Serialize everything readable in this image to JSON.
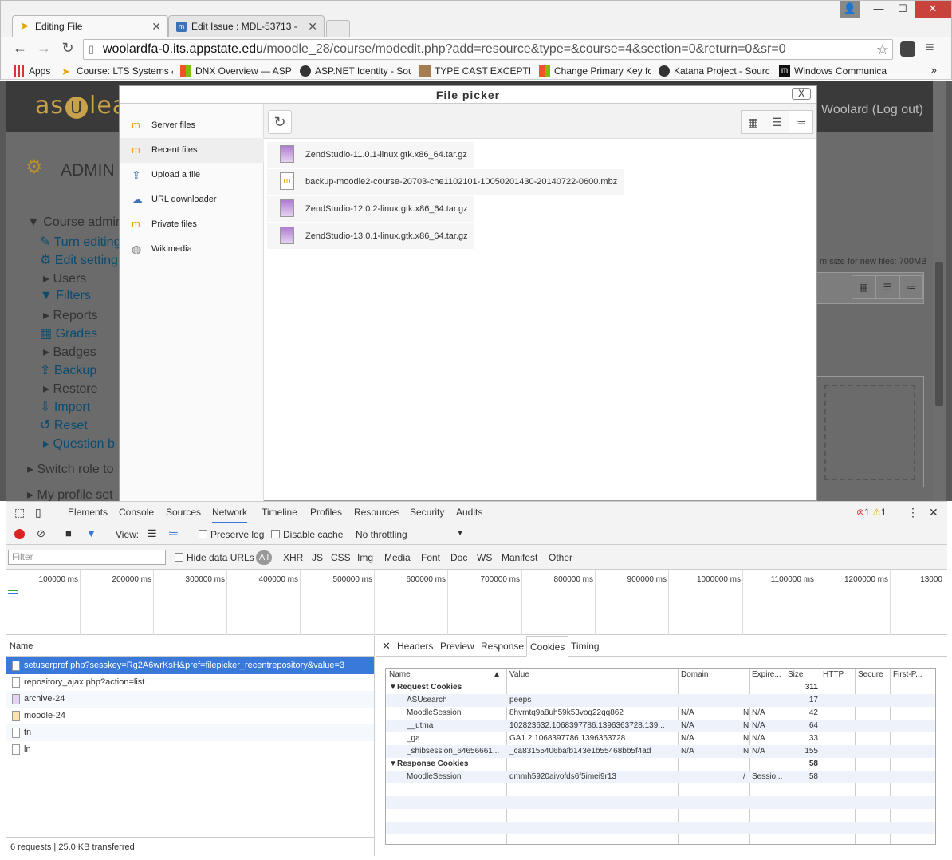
{
  "browser": {
    "tabs": [
      {
        "title": "Editing File",
        "active": true
      },
      {
        "title": "Edit Issue : MDL-53713 - ",
        "active": false
      }
    ],
    "url_host": "woolardfa-0.its.appstate.edu",
    "url_path": "/moodle_28/course/modedit.php?add=resource&type=&course=4&section=0&return=0&sr=0",
    "bookmarks": [
      "Apps",
      "Course: LTS Systems &",
      "DNX Overview — ASP",
      "ASP.NET Identity - Sou",
      "TYPE CAST EXCEPTION",
      "Change Primary Key fo",
      "Katana Project - Sourc",
      "Windows Communica"
    ]
  },
  "moodle": {
    "logo": "as",
    "logo_rest": "lea",
    "logout": "Woolard (Log out)",
    "admin_title": "ADMIN",
    "max_size": "m size for new files: 700MB",
    "nav": {
      "course_admin": "Course admin",
      "items": [
        {
          "label": "Turn editing",
          "link": true
        },
        {
          "label": "Edit setting",
          "link": true
        },
        {
          "label": "Users",
          "link": false
        },
        {
          "label": "Filters",
          "link": true
        },
        {
          "label": "Reports",
          "link": false
        },
        {
          "label": "Grades",
          "link": true
        },
        {
          "label": "Badges",
          "link": false
        },
        {
          "label": "Backup",
          "link": true
        },
        {
          "label": "Restore",
          "link": false
        },
        {
          "label": "Import",
          "link": true
        },
        {
          "label": "Reset",
          "link": true
        },
        {
          "label": "Question b",
          "link": true
        }
      ],
      "switch_role": "Switch role to",
      "my_profile": "My profile set"
    }
  },
  "filepicker": {
    "title": "File picker",
    "close": "X",
    "repositories": [
      {
        "label": "Server files",
        "icon": "moodle-icon",
        "active": false
      },
      {
        "label": "Recent files",
        "icon": "moodle-icon",
        "active": true
      },
      {
        "label": "Upload a file",
        "icon": "upload-icon",
        "active": false
      },
      {
        "label": "URL downloader",
        "icon": "url-icon",
        "active": false
      },
      {
        "label": "Private files",
        "icon": "moodle-icon",
        "active": false
      },
      {
        "label": "Wikimedia",
        "icon": "wikimedia-icon",
        "active": false
      }
    ],
    "files": [
      "ZendStudio-11.0.1-linux.gtk.x86_64.tar.gz",
      "backup-moodle2-course-20703-che1102101-10050201430-20140722-0600.mbz",
      "ZendStudio-12.0.2-linux.gtk.x86_64.tar.gz",
      "ZendStudio-13.0.1-linux.gtk.x86_64.tar.gz"
    ]
  },
  "devtools": {
    "tabs": [
      "Elements",
      "Console",
      "Sources",
      "Network",
      "Timeline",
      "Profiles",
      "Resources",
      "Security",
      "Audits"
    ],
    "active_tab": "Network",
    "errors": "1",
    "warnings": "1",
    "view_label": "View:",
    "preserve_log": "Preserve log",
    "disable_cache": "Disable cache",
    "throttling": "No throttling",
    "filter_placeholder": "Filter",
    "hide_data_urls": "Hide data URLs",
    "filter_types": [
      "All",
      "XHR",
      "JS",
      "CSS",
      "Img",
      "Media",
      "Font",
      "Doc",
      "WS",
      "Manifest",
      "Other"
    ],
    "timeline_ticks": [
      "100000 ms",
      "200000 ms",
      "300000 ms",
      "400000 ms",
      "500000 ms",
      "600000 ms",
      "700000 ms",
      "800000 ms",
      "900000 ms",
      "1000000 ms",
      "1100000 ms",
      "1200000 ms",
      "13000"
    ],
    "name_header": "Name",
    "requests": [
      "setuserpref.php?sesskey=Rg2A6wrKsH&pref=filepicker_recentrepository&value=3",
      "repository_ajax.php?action=list",
      "archive-24",
      "moodle-24",
      "tn",
      "ln"
    ],
    "footer": "6 requests  |  25.0 KB transferred",
    "detail_tabs": [
      "Headers",
      "Preview",
      "Response",
      "Cookies",
      "Timing"
    ],
    "detail_active": "Cookies",
    "cookie_columns": [
      "Name",
      "Value",
      "Domain",
      "",
      "Expire...",
      "Size",
      "HTTP",
      "Secure",
      "First-P..."
    ],
    "cookies": [
      {
        "name": "Request Cookies",
        "value": "",
        "domain": "",
        "path": "",
        "expires": "",
        "size": "311",
        "group": true
      },
      {
        "name": "ASUsearch",
        "value": "peeps",
        "domain": "",
        "path": "",
        "expires": "",
        "size": "17"
      },
      {
        "name": "MoodleSession",
        "value": "8hvmtq9a8uh59k53voq22qq862",
        "domain": "N/A",
        "path": "N",
        "expires": "N/A",
        "size": "42"
      },
      {
        "name": "__utma",
        "value": "102823632.1068397786.1396363728.139...",
        "domain": "N/A",
        "path": "N",
        "expires": "N/A",
        "size": "64"
      },
      {
        "name": "_ga",
        "value": "GA1.2.1068397786.1396363728",
        "domain": "N/A",
        "path": "N",
        "expires": "N/A",
        "size": "33"
      },
      {
        "name": "_shibsession_64656661...",
        "value": "_ca83155406bafb143e1b55468bb5f4ad",
        "domain": "N/A",
        "path": "N",
        "expires": "N/A",
        "size": "155"
      },
      {
        "name": "Response Cookies",
        "value": "",
        "domain": "",
        "path": "",
        "expires": "",
        "size": "58",
        "group": true
      },
      {
        "name": "MoodleSession",
        "value": "qmmh5920aivofds6f5imei9r13",
        "domain": "",
        "path": "/",
        "expires": "Sessio...",
        "size": "58"
      }
    ]
  },
  "colors": {
    "accent": "#3879d9",
    "moodle_link": "#0c4b6e",
    "close_btn": "#c9423b"
  }
}
